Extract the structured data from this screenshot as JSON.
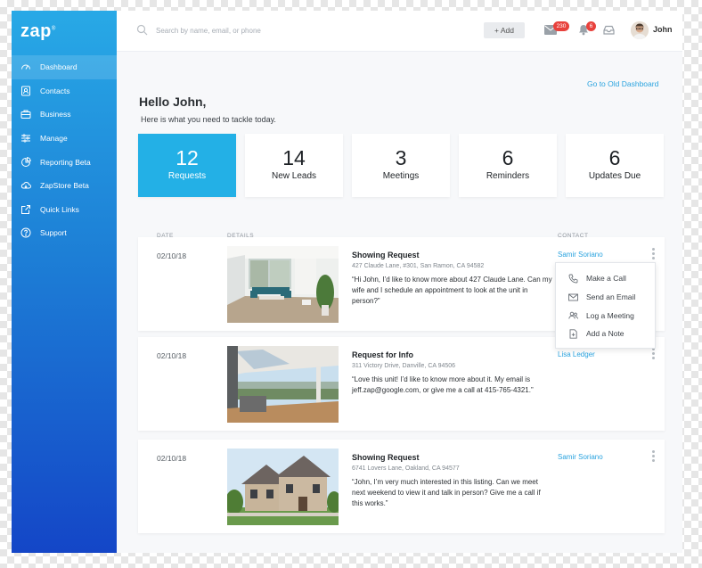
{
  "brand": {
    "logo": "zap"
  },
  "sidebar": {
    "items": [
      {
        "label": "Dashboard",
        "icon": "dashboard-icon"
      },
      {
        "label": "Contacts",
        "icon": "contacts-icon"
      },
      {
        "label": "Business",
        "icon": "briefcase-icon"
      },
      {
        "label": "Manage",
        "icon": "sliders-icon"
      },
      {
        "label": "Reporting Beta",
        "icon": "pie-chart-icon"
      },
      {
        "label": "ZapStore Beta",
        "icon": "cloud-icon"
      },
      {
        "label": "Quick Links",
        "icon": "external-link-icon"
      },
      {
        "label": "Support",
        "icon": "help-icon"
      }
    ]
  },
  "header": {
    "search_placeholder": "Search by name, email, or phone",
    "add_label": "+ Add",
    "mail_count": "230",
    "notification_count": "6",
    "user_name": "John"
  },
  "main": {
    "old_dashboard_link": "Go to Old Dashboard",
    "greeting": "Hello John,",
    "subtitle": "Here is what you need to tackle today."
  },
  "stats": [
    {
      "value": "12",
      "label": "Requests"
    },
    {
      "value": "14",
      "label": "New Leads"
    },
    {
      "value": "3",
      "label": "Meetings"
    },
    {
      "value": "6",
      "label": "Reminders"
    },
    {
      "value": "6",
      "label": "Updates Due"
    }
  ],
  "table": {
    "headers": {
      "date": "DATE",
      "details": "DETAILS",
      "contact": "CONTACT"
    },
    "rows": [
      {
        "date": "02/10/18",
        "title": "Showing Request",
        "address": "427 Claude Lane, #301, San Ramon, CA 94582",
        "message": "“Hi John, I’d like to know more about 427 Claude Lane. Can my wife and I schedule an appointment to look at the unit in person?”",
        "contact": "Samir Soriano"
      },
      {
        "date": "02/10/18",
        "title": "Request for Info",
        "address": "311 Victory Drive, Danville, CA 94506",
        "message": "“Love this unit! I’d like to know more about it. My email is jeff.zap@google.com, or give me a call at 415-765-4321.”",
        "contact": "Lisa Ledger"
      },
      {
        "date": "02/10/18",
        "title": "Showing Request",
        "address": "6741 Lovers Lane, Oakland, CA 94577",
        "message": "“John, I’m very much interested in this listing. Can we meet next weekend to view it and talk in person? Give me a call if this works.”",
        "contact": "Samir Soriano"
      }
    ]
  },
  "context_menu": {
    "items": [
      {
        "label": "Make a Call",
        "icon": "phone-icon"
      },
      {
        "label": "Send an Email",
        "icon": "envelope-icon"
      },
      {
        "label": "Log a Meeting",
        "icon": "people-icon"
      },
      {
        "label": "Add a Note",
        "icon": "note-icon"
      }
    ]
  },
  "colors": {
    "accent": "#23b0e6",
    "link": "#2aa3df",
    "badge": "#e8413c"
  }
}
